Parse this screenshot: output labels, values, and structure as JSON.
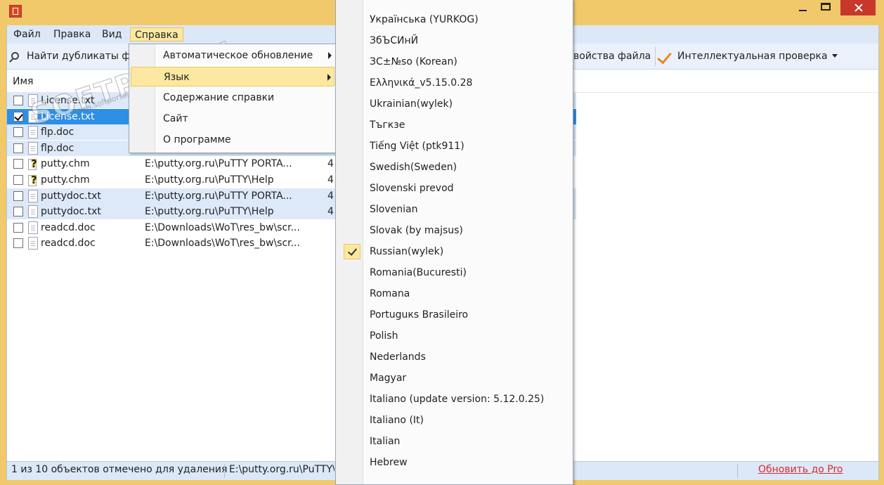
{
  "menubar": {
    "items": [
      "Файл",
      "Правка",
      "Вид",
      "Справка"
    ]
  },
  "toolbar": {
    "find_duplicates": "Найти дубликаты фа",
    "file_properties": "войства файла",
    "smart_check": "Интеллектуальная проверка"
  },
  "list": {
    "col_name": "Имя",
    "rows": [
      {
        "name": "License.txt",
        "path": "",
        "size": "",
        "checked": false,
        "icon": "doc-icon",
        "style": "alt"
      },
      {
        "name": "License.txt",
        "path": "",
        "size": "",
        "checked": true,
        "icon": "doc-icon",
        "style": "sel"
      },
      {
        "name": "flp.doc",
        "path": "",
        "size": "",
        "checked": false,
        "icon": "doc-icon",
        "style": "alt"
      },
      {
        "name": "flp.doc",
        "path": "",
        "size": "",
        "checked": false,
        "icon": "doc-icon",
        "style": "alt"
      },
      {
        "name": "putty.chm",
        "path": "E:\\putty.org.ru\\PuTTY PORTA...",
        "size": "4",
        "checked": false,
        "icon": "help-file-icon",
        "style": ""
      },
      {
        "name": "putty.chm",
        "path": "E:\\putty.org.ru\\PuTTY\\Help",
        "size": "4",
        "checked": false,
        "icon": "help-file-icon",
        "style": ""
      },
      {
        "name": "puttydoc.txt",
        "path": "E:\\putty.org.ru\\PuTTY PORTA...",
        "size": "4",
        "checked": false,
        "icon": "doc-icon",
        "style": "alt"
      },
      {
        "name": "puttydoc.txt",
        "path": "E:\\putty.org.ru\\PuTTY\\Help",
        "size": "4",
        "checked": false,
        "icon": "doc-icon",
        "style": "alt"
      },
      {
        "name": "readcd.doc",
        "path": "E:\\Downloads\\WoT\\res_bw\\scr...",
        "size": "",
        "checked": false,
        "icon": "doc-icon",
        "style": ""
      },
      {
        "name": "readcd.doc",
        "path": "E:\\Downloads\\WoT\\res_bw\\scr...",
        "size": "",
        "checked": false,
        "icon": "doc-icon",
        "style": ""
      }
    ]
  },
  "help_menu": {
    "items": [
      {
        "label": "Автоматическое обновление",
        "submenu": true,
        "highlight": false
      },
      {
        "label": "Язык",
        "submenu": true,
        "highlight": true
      },
      {
        "label": "Содержание справки",
        "submenu": false,
        "highlight": false
      },
      {
        "label": "Сайт",
        "submenu": false,
        "highlight": false
      },
      {
        "label": "О программе",
        "submenu": false,
        "highlight": false
      }
    ]
  },
  "language_menu": {
    "items": [
      {
        "label": "Українська (YURKOG)",
        "checked": false
      },
      {
        "label": "ЗбЪСИнЙ",
        "checked": false
      },
      {
        "label": "ЗС±№ѕо (Korean)",
        "checked": false
      },
      {
        "label": "Ελληνικά_v5.15.0.28",
        "checked": false
      },
      {
        "label": "Ukrainian(wylek)",
        "checked": false
      },
      {
        "label": "Тъгкзе",
        "checked": false
      },
      {
        "label": "Tiếng Việt (ptk911)",
        "checked": false
      },
      {
        "label": "Swedish(Sweden)",
        "checked": false
      },
      {
        "label": "Slovenski prevod",
        "checked": false
      },
      {
        "label": "Slovenian",
        "checked": false
      },
      {
        "label": "Slovak (by majsus)",
        "checked": false
      },
      {
        "label": "Russian(wylek)",
        "checked": true
      },
      {
        "label": "Romania(Bucuresti)",
        "checked": false
      },
      {
        "label": "Romana",
        "checked": false
      },
      {
        "label": "Portuguкs Brasileiro",
        "checked": false
      },
      {
        "label": "Polish",
        "checked": false
      },
      {
        "label": "Nederlands",
        "checked": false
      },
      {
        "label": "Magyar",
        "checked": false
      },
      {
        "label": "Italiano (update version: 5.12.0.25)",
        "checked": false
      },
      {
        "label": "Italiano (It)",
        "checked": false
      },
      {
        "label": "Italian",
        "checked": false
      },
      {
        "label": "Hebrew",
        "checked": false
      }
    ]
  },
  "statusbar": {
    "selected_text": "1 из 10 объектов отмечено для удаления",
    "path_text": "E:\\putty.org.ru\\PuTTY\\Help",
    "upgrade_link": "Обновить до Pro"
  },
  "watermark": {
    "text": "SOFTPORTAL",
    "sub": "www.softportal.com"
  },
  "colors": {
    "title_bar": "#f1c96b",
    "close_button": "#c7372c",
    "selection": "#2e8fe6",
    "menu_highlight": "#fce8a0",
    "link": "#d52d2d"
  }
}
